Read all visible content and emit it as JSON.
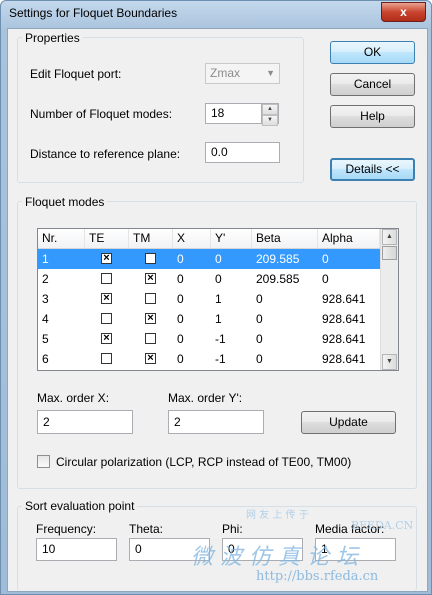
{
  "window": {
    "title": "Settings for Floquet Boundaries",
    "close_glyph": "x"
  },
  "buttons": {
    "ok": "OK",
    "cancel": "Cancel",
    "help": "Help",
    "details": "Details <<",
    "update": "Update"
  },
  "properties": {
    "group_label": "Properties",
    "edit_port_label": "Edit Floquet port:",
    "edit_port_value": "Zmax",
    "num_modes_label": "Number of Floquet modes:",
    "num_modes_value": "18",
    "distance_label": "Distance to reference plane:",
    "distance_value": "0.0"
  },
  "floquet_modes": {
    "group_label": "Floquet modes",
    "columns": [
      "Nr.",
      "TE",
      "TM",
      "X",
      "Y'",
      "Beta",
      "Alpha"
    ],
    "rows": [
      {
        "nr": "1",
        "te": true,
        "tm": false,
        "x": "0",
        "y": "0",
        "beta": "209.585",
        "alpha": "0",
        "selected": true
      },
      {
        "nr": "2",
        "te": false,
        "tm": true,
        "x": "0",
        "y": "0",
        "beta": "209.585",
        "alpha": "0",
        "selected": false
      },
      {
        "nr": "3",
        "te": true,
        "tm": false,
        "x": "0",
        "y": "1",
        "beta": "0",
        "alpha": "928.641",
        "selected": false
      },
      {
        "nr": "4",
        "te": false,
        "tm": true,
        "x": "0",
        "y": "1",
        "beta": "0",
        "alpha": "928.641",
        "selected": false
      },
      {
        "nr": "5",
        "te": true,
        "tm": false,
        "x": "0",
        "y": "-1",
        "beta": "0",
        "alpha": "928.641",
        "selected": false
      },
      {
        "nr": "6",
        "te": false,
        "tm": true,
        "x": "0",
        "y": "-1",
        "beta": "0",
        "alpha": "928.641",
        "selected": false
      }
    ],
    "max_order_x_label": "Max. order X:",
    "max_order_x_value": "2",
    "max_order_y_label": "Max. order Y':",
    "max_order_y_value": "2",
    "circular_label": "Circular polarization (LCP, RCP instead of TE00, TM00)",
    "circular_checked": false
  },
  "sort": {
    "group_label": "Sort evaluation point",
    "frequency_label": "Frequency:",
    "frequency_value": "10",
    "theta_label": "Theta:",
    "theta_value": "0",
    "phi_label": "Phi:",
    "phi_value": "0",
    "media_label": "Media factor:",
    "media_value": "1"
  },
  "watermark": {
    "line1": "网 友 上 传 于",
    "line2": "RFEDA.CN",
    "line3": "微 波 仿 真 论 坛",
    "line4": "http://bbs.rfeda.cn"
  },
  "colors": {
    "selection": "#3399ff",
    "title_bar": "#b9d1ea",
    "close_button": "#c9452f"
  }
}
